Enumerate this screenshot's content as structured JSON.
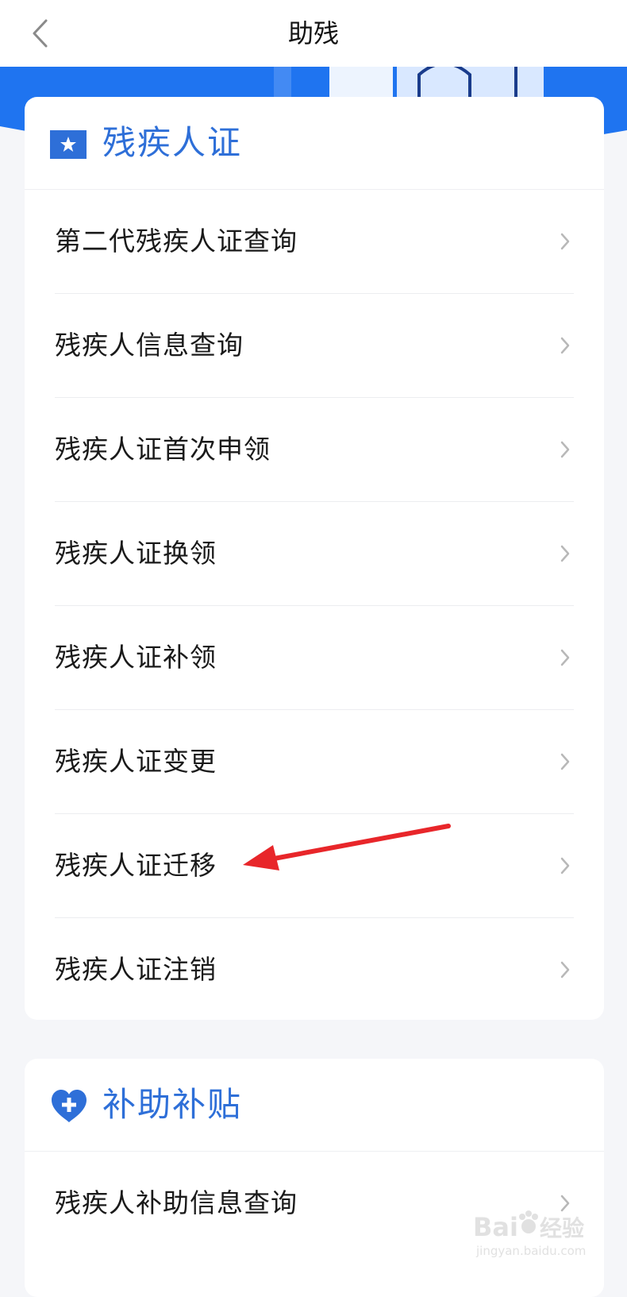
{
  "navbar": {
    "title": "助残"
  },
  "sections": [
    {
      "title": "残疾人证",
      "icon": "star-icon",
      "items": [
        {
          "label": "第二代残疾人证查询"
        },
        {
          "label": "残疾人信息查询"
        },
        {
          "label": "残疾人证首次申领"
        },
        {
          "label": "残疾人证换领"
        },
        {
          "label": "残疾人证补领"
        },
        {
          "label": "残疾人证变更"
        },
        {
          "label": "残疾人证迁移"
        },
        {
          "label": "残疾人证注销"
        }
      ]
    },
    {
      "title": "补助补贴",
      "icon": "heart-plus-icon",
      "items": [
        {
          "label": "残疾人补助信息查询"
        }
      ]
    }
  ],
  "colors": {
    "accent": "#2e6fd8",
    "banner": "#1f74f0",
    "annotation_arrow": "#e8262a",
    "background": "#f5f6f9"
  }
}
